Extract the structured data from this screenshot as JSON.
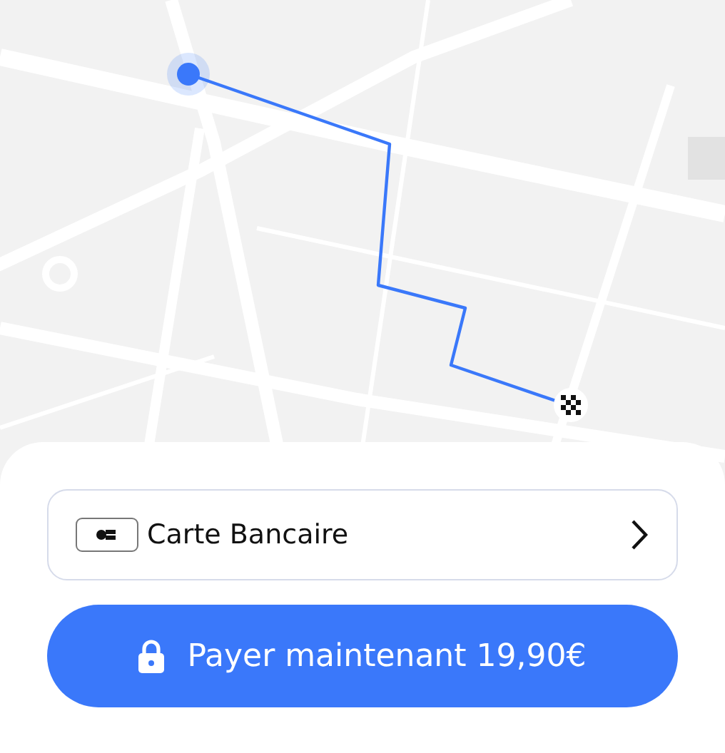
{
  "payment_method": {
    "label": "Carte Bancaire"
  },
  "pay_button": {
    "label": "Payer maintenant 19,90€"
  }
}
